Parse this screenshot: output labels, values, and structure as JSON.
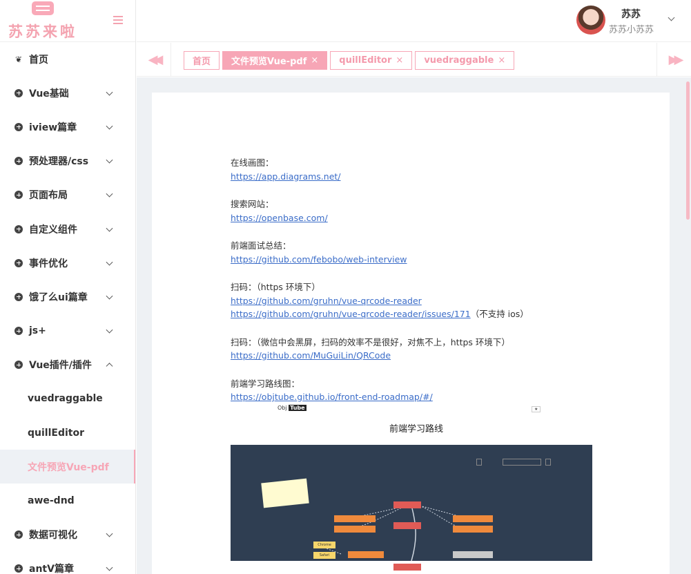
{
  "brand": {
    "logo_text": "苏苏来啦"
  },
  "sidebar": {
    "items": [
      {
        "label": "首页",
        "icon": "paw-icon"
      },
      {
        "label": "Vue基础",
        "icon": "circle-plus-icon",
        "expandable": true
      },
      {
        "label": "iview篇章",
        "icon": "circle-plus-icon",
        "expandable": true
      },
      {
        "label": "预处理器/css",
        "icon": "circle-plus-icon",
        "expandable": true
      },
      {
        "label": "页面布局",
        "icon": "circle-plus-icon",
        "expandable": true
      },
      {
        "label": "自定义组件",
        "icon": "circle-plus-icon",
        "expandable": true
      },
      {
        "label": "事件优化",
        "icon": "circle-plus-icon",
        "expandable": true
      },
      {
        "label": "饿了么ui篇章",
        "icon": "circle-plus-icon",
        "expandable": true
      },
      {
        "label": "js+",
        "icon": "circle-plus-icon",
        "expandable": true
      },
      {
        "label": "Vue插件/插件",
        "icon": "circle-plus-icon",
        "expandable": true,
        "expanded": true
      },
      {
        "label": "vuedraggable",
        "sub": true
      },
      {
        "label": "quillEditor",
        "sub": true
      },
      {
        "label": "文件预览Vue-pdf",
        "sub": true,
        "active": true
      },
      {
        "label": "awe-dnd",
        "sub": true
      },
      {
        "label": "数据可视化",
        "icon": "circle-plus-icon",
        "expandable": true
      },
      {
        "label": "antV篇章",
        "icon": "circle-plus-icon",
        "expandable": true
      }
    ]
  },
  "header": {
    "user_name": "苏苏",
    "user_subtitle": "苏苏小苏苏"
  },
  "tabs": [
    {
      "label": "首页",
      "closable": false
    },
    {
      "label": "文件预览Vue-pdf",
      "closable": true,
      "active": true
    },
    {
      "label": "quillEditor",
      "closable": true
    },
    {
      "label": "vuedraggable",
      "closable": true
    }
  ],
  "tab_nav": {
    "left": "◀◀",
    "right": "▶▶",
    "close_glyph": "×"
  },
  "document": {
    "blocks": [
      {
        "lines": [
          {
            "text": "在线画图："
          },
          {
            "link": "https://app.diagrams.net/"
          }
        ]
      },
      {
        "lines": [
          {
            "text": "搜索网站："
          },
          {
            "link": "https://openbase.com/"
          }
        ]
      },
      {
        "lines": [
          {
            "text": "前端面试总结："
          },
          {
            "link": "https://github.com/febobo/web-interview"
          }
        ]
      },
      {
        "lines": [
          {
            "text": "扫码：（https 环境下）"
          },
          {
            "link": "https://github.com/gruhn/vue-qrcode-reader"
          },
          {
            "link": "https://github.com/gruhn/vue-qrcode-reader/issues/171",
            "suffix": "（不支持 ios）"
          }
        ]
      },
      {
        "lines": [
          {
            "text": "扫码：（微信中会黑屏，扫码的效率不是很好，对焦不上，https 环境下）"
          },
          {
            "link": "https://github.com/MuGuiLin/QRCode"
          }
        ]
      },
      {
        "lines": [
          {
            "text": "前端学习路线图："
          },
          {
            "link": "https://objtube.github.io/front-end-roadmap/#/"
          }
        ]
      }
    ]
  },
  "roadmap": {
    "brand_a": "Obj",
    "brand_b": "Tube",
    "title": "前端学习路线",
    "nodes": [
      {
        "label": "",
        "color": "red"
      },
      {
        "label": "",
        "color": "red"
      },
      {
        "label": "",
        "color": "orange"
      },
      {
        "label": "",
        "color": "orange"
      },
      {
        "label": "",
        "color": "orange"
      },
      {
        "label": "",
        "color": "orange"
      },
      {
        "label": "",
        "color": "orange"
      },
      {
        "label": "Chrome",
        "color": "yellow"
      },
      {
        "label": "Safari",
        "color": "yellow"
      },
      {
        "label": "",
        "color": "red"
      },
      {
        "label": "",
        "color": "gray"
      }
    ]
  }
}
